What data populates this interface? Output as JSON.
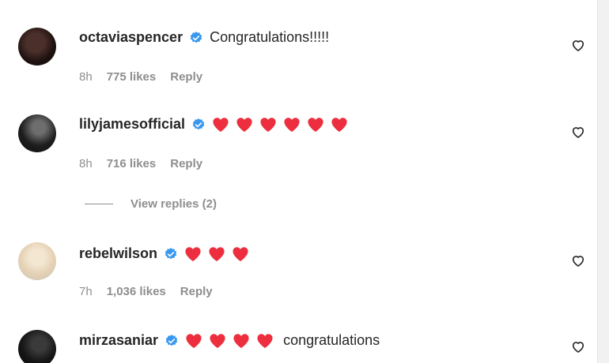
{
  "comments": [
    {
      "username": "octaviaspencer",
      "verified": true,
      "hearts": 0,
      "text": "Congratulations!!!!!",
      "time": "8h",
      "likes": "775 likes",
      "reply": "Reply"
    },
    {
      "username": "lilyjamesofficial",
      "verified": true,
      "hearts": 6,
      "text": "",
      "time": "8h",
      "likes": "716 likes",
      "reply": "Reply"
    },
    {
      "username": "rebelwilson",
      "verified": true,
      "hearts": 3,
      "text": "",
      "time": "7h",
      "likes": "1,036 likes",
      "reply": "Reply"
    },
    {
      "username": "mirzasaniar",
      "verified": true,
      "hearts": 4,
      "text": "congratulations",
      "time": "",
      "likes": "",
      "reply": ""
    }
  ],
  "view_replies": "View replies (2)",
  "colors": {
    "verified": "#3897f0",
    "heart": "#ed4956",
    "meta": "#8e8e8e",
    "text": "#262626"
  },
  "icons": {
    "verified": "verified-badge-icon",
    "heart_emoji": "red-heart-icon",
    "like": "heart-outline-icon"
  }
}
